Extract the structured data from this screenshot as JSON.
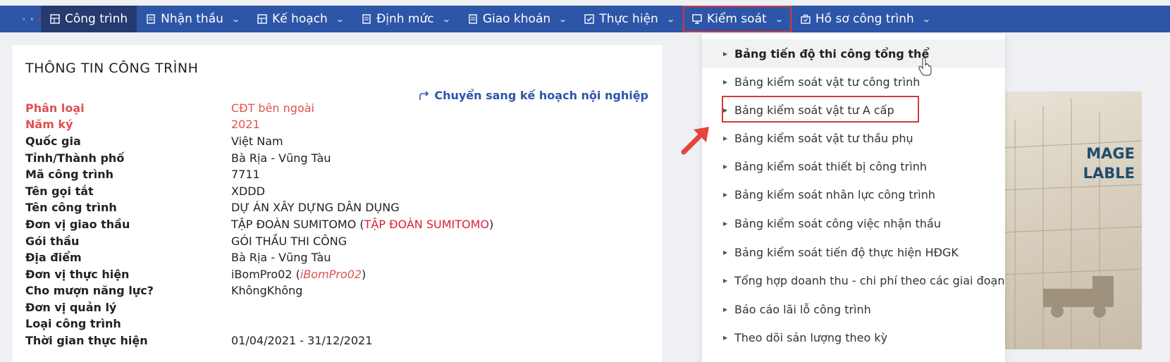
{
  "nav": {
    "items": [
      {
        "label": "Công trình",
        "icon": "grid-icon"
      },
      {
        "label": "Nhận thầu",
        "icon": "document-icon"
      },
      {
        "label": "Kế hoạch",
        "icon": "grid-icon"
      },
      {
        "label": "Định mức",
        "icon": "document-icon"
      },
      {
        "label": "Giao khoán",
        "icon": "document-icon"
      },
      {
        "label": "Thực hiện",
        "icon": "checkbox-icon"
      },
      {
        "label": "Kiểm soát",
        "icon": "monitor-icon"
      },
      {
        "label": "Hồ sơ công trình",
        "icon": "briefcase-icon"
      }
    ]
  },
  "card": {
    "title": "THÔNG TIN CÔNG TRÌNH",
    "switch_link": "Chuyển sang kế hoạch nội nghiệp",
    "rows": [
      {
        "label": "Phân loại",
        "value": "CĐT bên ngoài"
      },
      {
        "label": "Năm ký",
        "value": "2021"
      },
      {
        "label": "Quốc gia",
        "value": "Việt Nam"
      },
      {
        "label": "Tỉnh/Thành phố",
        "value": "Bà Rịa - Vũng Tàu"
      },
      {
        "label": "Mã công trình",
        "value": "7711"
      },
      {
        "label": "Tên gọi tắt",
        "value": "XDDD"
      },
      {
        "label": "Tên công trình",
        "value": "DỰ ÁN XÂY DỰNG DÂN DỤNG"
      },
      {
        "label": "Đơn vị giao thầu",
        "value": "TẬP ĐOÀN SUMITOMO",
        "extra": "TẬP ĐOÀN SUMITOMO"
      },
      {
        "label": "Gói thầu",
        "value": "GÓI THẦU THI CÔNG"
      },
      {
        "label": "Địa điểm",
        "value": "Bà Rịa - Vũng Tàu"
      },
      {
        "label": "Đơn vị thực hiện",
        "value": "iBomPro02",
        "extra": "iBomPro02"
      },
      {
        "label": "Cho mượn năng lực?",
        "value": "KhôngKhông"
      },
      {
        "label": "Đơn vị quản lý",
        "value": ""
      },
      {
        "label": "Loại công trình",
        "value": ""
      },
      {
        "label": "Thời gian thực hiện",
        "value": "01/04/2021 - 31/12/2021"
      }
    ]
  },
  "dropdown": {
    "items": [
      "Bảng tiến độ thi công tổng thể",
      "Bảng kiểm soát vật tư công trình",
      "Bảng kiểm soát vật tư A cấp",
      "Bảng kiểm soát vật tư thầu phụ",
      "Bảng kiểm soát thiết bị công trình",
      "Bảng kiểm soát nhân lực công trình",
      "Bảng kiểm soát công việc nhận thầu",
      "Bảng kiểm soát tiến độ thực hiện HĐGK",
      "Tổng hợp doanh thu - chi phí theo các giai đoạn",
      "Báo cáo lãi lỗ công trình",
      "Theo dõi sản lượng theo kỳ"
    ]
  },
  "side_image": {
    "line1": "MAGE",
    "line2": "LABLE"
  },
  "colors": {
    "nav_bg": "#2d55a8",
    "nav_active": "#253a6f",
    "highlight": "#d93838",
    "label_red": "#e05050"
  }
}
